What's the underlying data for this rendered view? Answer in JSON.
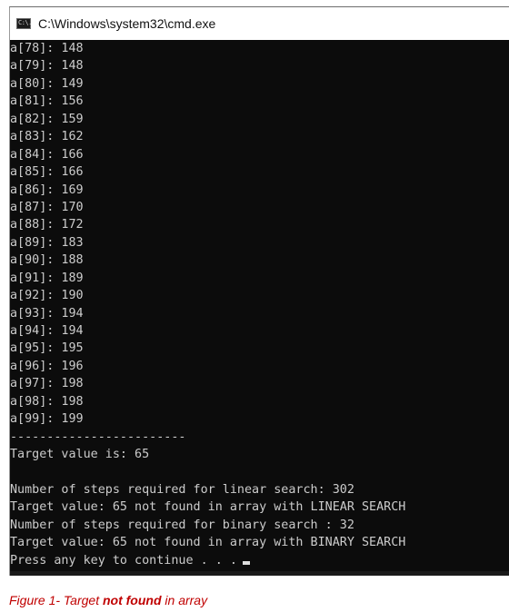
{
  "window": {
    "title": "C:\\Windows\\system32\\cmd.exe",
    "icon_label": "C:\\."
  },
  "console": {
    "lines": [
      "a[78]: 148",
      "a[79]: 148",
      "a[80]: 149",
      "a[81]: 156",
      "a[82]: 159",
      "a[83]: 162",
      "a[84]: 166",
      "a[85]: 166",
      "a[86]: 169",
      "a[87]: 170",
      "a[88]: 172",
      "a[89]: 183",
      "a[90]: 188",
      "a[91]: 189",
      "a[92]: 190",
      "a[93]: 194",
      "a[94]: 194",
      "a[95]: 195",
      "a[96]: 196",
      "a[97]: 198",
      "a[98]: 198",
      "a[99]: 199",
      "------------------------",
      "Target value is: 65",
      "",
      "Number of steps required for linear search: 302",
      "Target value: 65 not found in array with LINEAR SEARCH",
      "Number of steps required for binary search : 32",
      "Target value: 65 not found in array with BINARY SEARCH"
    ],
    "prompt": "Press any key to continue . . ."
  },
  "caption": {
    "prefix": "Figure 1- Target ",
    "emphasis": "not found",
    "suffix": " in array"
  }
}
